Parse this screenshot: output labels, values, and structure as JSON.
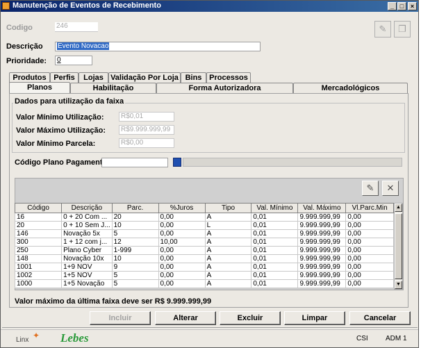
{
  "window": {
    "title": "Manutenção de Eventos de Recebimento"
  },
  "form": {
    "codigo_label": "Codigo",
    "codigo_value": "246",
    "descricao_label": "Descrição",
    "descricao_value": "Evento Novacao",
    "prioridade_label": "Prioridade:",
    "prioridade_value": "0"
  },
  "tabs_row1": [
    "Produtos",
    "Perfis",
    "Lojas",
    "Validação Por Loja",
    "Bins",
    "Processos"
  ],
  "tabs_row2": [
    "Planos",
    "Habilitação",
    "Forma Autorizadora",
    "Mercadológicos"
  ],
  "faixa": {
    "title": "Dados para utilização da faixa",
    "min_util_label": "Valor Mínimo Utilização:",
    "min_util_value": "R$0,01",
    "max_util_label": "Valor Máximo Utilização:",
    "max_util_value": "R$9.999.999,99",
    "min_parcela_label": "Valor Mínimo Parcela:",
    "min_parcela_value": "R$0,00"
  },
  "plano": {
    "label": "Código Plano Pagamento",
    "value": ""
  },
  "table": {
    "columns": [
      "Código",
      "Descrição",
      "Parc.",
      "%Juros",
      "Tipo",
      "Val. Mínimo",
      "Val. Máximo",
      "Vl.Parc.Min"
    ],
    "rows": [
      [
        "16",
        "0 + 20 Com ...",
        "20",
        "0,00",
        "A",
        "0,01",
        "9.999.999,99",
        "0,00"
      ],
      [
        "20",
        "0 + 10 Sem J...",
        "10",
        "0,00",
        "L",
        "0,01",
        "9.999.999,99",
        "0,00"
      ],
      [
        "146",
        "Novação 5x",
        "5",
        "0,00",
        "A",
        "0,01",
        "9.999.999,99",
        "0,00"
      ],
      [
        "300",
        "1 + 12 com j...",
        "12",
        "10,00",
        "A",
        "0,01",
        "9.999.999,99",
        "0,00"
      ],
      [
        "250",
        "Plano Cyber",
        "1-999",
        "0,00",
        "A",
        "0,01",
        "9.999.999,99",
        "0,00"
      ],
      [
        "148",
        "Novação 10x",
        "10",
        "0,00",
        "A",
        "0,01",
        "9.999.999,99",
        "0,00"
      ],
      [
        "1001",
        "1+9 NOV",
        "9",
        "0,00",
        "A",
        "0,01",
        "9.999.999,99",
        "0,00"
      ],
      [
        "1002",
        "1+5 NOV",
        "5",
        "0,00",
        "A",
        "0,01",
        "9.999.999,99",
        "0,00"
      ],
      [
        "1000",
        "1+5 Novação",
        "5",
        "0,00",
        "A",
        "0,01",
        "9.999.999,99",
        "0,00"
      ]
    ]
  },
  "footer_note": "Valor máximo da última faixa deve ser R$ 9.999.999,99",
  "buttons": {
    "incluir": "Incluir",
    "alterar": "Alterar",
    "excluir": "Excluir",
    "limpar": "Limpar",
    "cancelar": "Cancelar"
  },
  "status": {
    "logo1": "Linx",
    "logo2": "Lebes",
    "left": "CSI",
    "right": "ADM 1"
  },
  "icons": {
    "title": "app-icon",
    "toolbar": [
      "pin-icon",
      "document-icon"
    ],
    "grid": [
      "edit-row-icon",
      "delete-row-icon"
    ]
  },
  "colors": {
    "titlebar": "#0a246a",
    "selection": "#316ac5",
    "logo_green": "#2a9a3a",
    "logo_orange": "#e07020"
  }
}
